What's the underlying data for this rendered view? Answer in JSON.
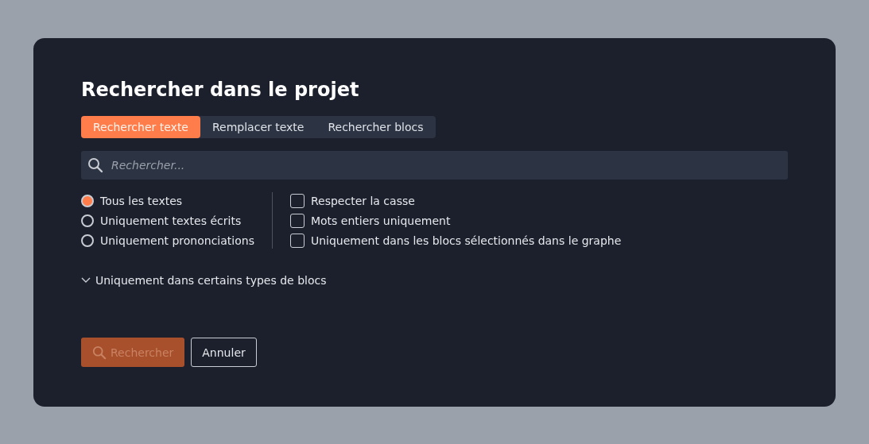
{
  "dialog": {
    "title": "Rechercher dans le projet"
  },
  "tabs": [
    {
      "label": "Rechercher texte",
      "selected": true
    },
    {
      "label": "Remplacer texte",
      "selected": false
    },
    {
      "label": "Rechercher blocs",
      "selected": false
    }
  ],
  "search": {
    "placeholder": "Rechercher..."
  },
  "scope_options": [
    {
      "label": "Tous les textes",
      "selected": true
    },
    {
      "label": "Uniquement textes écrits",
      "selected": false
    },
    {
      "label": "Uniquement prononciations",
      "selected": false
    }
  ],
  "filters": [
    {
      "label": "Respecter la casse",
      "checked": false
    },
    {
      "label": "Mots entiers uniquement",
      "checked": false
    },
    {
      "label": "Uniquement dans les blocs sélectionnés dans le graphe",
      "checked": false
    }
  ],
  "block_types": {
    "label": "Uniquement dans certains types de blocs",
    "expanded": false
  },
  "buttons": [
    {
      "label": "Rechercher",
      "kind": "primary",
      "disabled": true
    },
    {
      "label": "Annuler",
      "kind": "secondary",
      "disabled": false
    }
  ]
}
